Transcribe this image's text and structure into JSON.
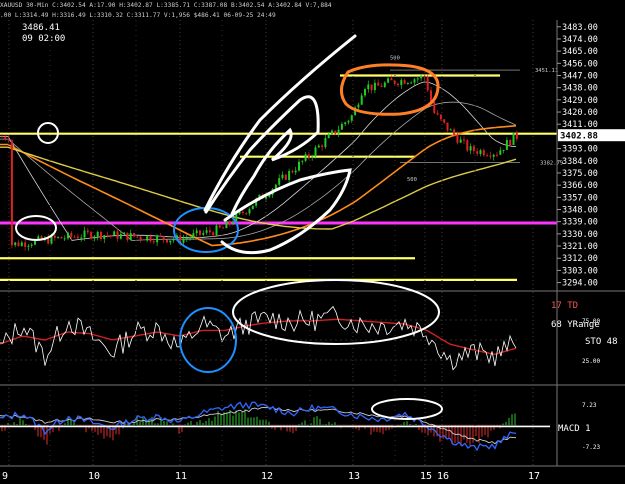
{
  "header": {
    "symbol_line": "XAUUSD 30-Min C:3402.54 A:17.90 H:3402.87 L:3385.71 C:3387.08 B:3402.54 A:3402.84 V:7,884",
    "ohlc_line": ".00 L:3314.49 H:3316.49 L:3310.32 C:3311.77 V:1,956 $486.41 06-09-25 24:49",
    "cursor_value": "3486.41",
    "cursor_time": "09 02:00"
  },
  "colors": {
    "background": "#000000",
    "candle_up": "#22cc22",
    "candle_down": "#dd2222",
    "yellow_level": "#ffff66",
    "magenta_level": "#ff33ff",
    "orange_ma": "#ff8c1a",
    "white_ma": "#ffffff",
    "stoch_fast": "#ffffff",
    "stoch_slow": "#cc2222",
    "macd_line": "#3366ff",
    "macd_signal": "#cccccc",
    "annotation_white": "#ffffff",
    "annotation_orange": "#ff7f27",
    "annotation_blue": "#1e90ff",
    "price_label_bg": "#ffffff"
  },
  "chart_data": [
    {
      "type": "candlestick",
      "panel": "price",
      "ylim": [
        3290,
        3488
      ],
      "yticks": [
        3483,
        3474,
        3465,
        3456,
        3447,
        3438,
        3429,
        3420,
        3411,
        3393,
        3384,
        3375,
        3366,
        3357,
        3348,
        3339,
        3330,
        3321,
        3312,
        3303,
        3294
      ],
      "last_price_label": "3402.88",
      "x": [
        "9",
        "10",
        "11",
        "12",
        "13",
        "15",
        "16",
        "17"
      ],
      "close_path": [
        [
          "9",
          3322
        ],
        [
          "9.5",
          3326
        ],
        [
          "10",
          3330
        ],
        [
          "10.5",
          3328
        ],
        [
          "11",
          3326
        ],
        [
          "11.5",
          3334
        ],
        [
          "12",
          3360
        ],
        [
          "12.5",
          3388
        ],
        [
          "13",
          3418
        ],
        [
          "13.3",
          3440
        ],
        [
          "13.6",
          3438
        ],
        [
          "14",
          3442
        ],
        [
          "15",
          3446
        ],
        [
          "15.5",
          3420
        ],
        [
          "16",
          3412
        ],
        [
          "16.3",
          3392
        ],
        [
          "16.6",
          3390
        ],
        [
          "16.8",
          3402
        ]
      ],
      "levels": [
        {
          "value": 3447,
          "color": "yellow"
        },
        {
          "value": 3404,
          "color": "yellow"
        },
        {
          "value": 3387,
          "color": "yellow"
        },
        {
          "value": 3338,
          "color": "magenta"
        },
        {
          "value": 3312,
          "color": "yellow"
        },
        {
          "value": 3296,
          "color": "yellow"
        }
      ],
      "annotations": [
        "3451.11",
        "3382.79",
        "500",
        "500"
      ]
    },
    {
      "type": "line",
      "panel": "stochastic",
      "labels": [
        "17 TD",
        "68 YRange",
        "STO 48"
      ],
      "yticks": [
        "75.00",
        "25.00"
      ],
      "ylim": [
        0,
        100
      ],
      "series": [
        {
          "values": [
            40,
            70,
            30,
            75,
            55,
            35,
            60,
            65,
            40,
            70,
            55,
            70,
            78,
            72,
            75,
            80,
            70,
            68,
            72,
            60,
            25,
            35,
            30,
            48
          ]
        },
        {
          "values": [
            45,
            55,
            50,
            60,
            58,
            50,
            55,
            60,
            55,
            62,
            62,
            68,
            72,
            74,
            74,
            76,
            74,
            72,
            70,
            62,
            45,
            38,
            32,
            40
          ]
        }
      ]
    },
    {
      "type": "line",
      "panel": "macd",
      "labels": [
        "MACD 1"
      ],
      "yticks": [
        "7.23",
        "-7.23"
      ],
      "ylim": [
        -12,
        12
      ],
      "series": [
        {
          "values": [
            2,
            4,
            -2,
            3,
            1,
            -1,
            2,
            3,
            1,
            4,
            6,
            7,
            6,
            4,
            6,
            5,
            3,
            2,
            4,
            0,
            -5,
            -8,
            -7,
            -2
          ]
        },
        {
          "values": [
            3,
            3,
            1,
            2,
            2,
            1,
            1,
            2,
            2,
            3,
            4,
            5,
            6,
            5,
            5,
            5,
            4,
            3,
            3,
            1,
            -2,
            -5,
            -6,
            -4
          ]
        }
      ]
    }
  ]
}
